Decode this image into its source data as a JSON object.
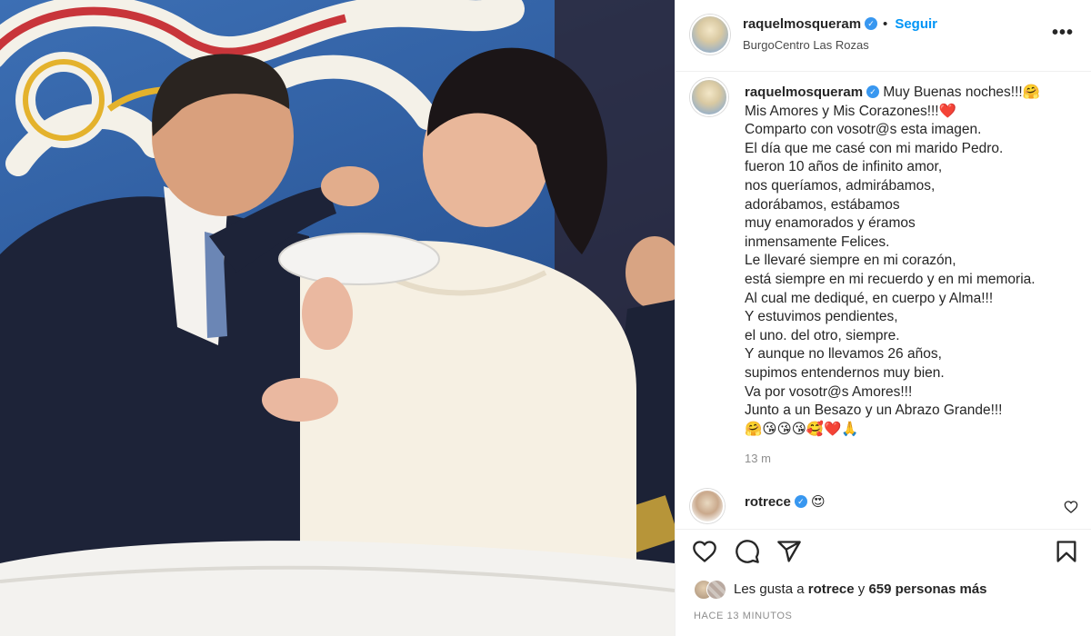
{
  "post": {
    "username": "raquelmosqueram",
    "follow_label": "Seguir",
    "location": "BurgoCentro Las Rozas",
    "more_label": "•••",
    "caption_lines": [
      "Muy Buenas noches!!!🤗",
      "Mis Amores y Mis Corazones!!!❤️",
      "Comparto con vosotr@s esta imagen.",
      "El día que me casé con mi marido Pedro.",
      "fueron 10 años de infinito amor,",
      "nos queríamos, admirábamos,",
      "adorábamos, estábamos",
      "muy enamorados y éramos",
      "inmensamente Felices.",
      "Le llevaré siempre en mi corazón,",
      "está siempre en mi recuerdo y en mi memoria.",
      "Al cual me dediqué, en cuerpo y Alma!!!",
      "Y estuvimos pendientes,",
      "el uno. del otro, siempre.",
      "Y aunque no llevamos 26 años,",
      "supimos entendernos muy bien.",
      "Va por vosotr@s Amores!!!",
      "Junto a un Besazo y un Abrazo Grande!!!",
      "🤗😘😘😘🥰❤️🙏"
    ],
    "caption_time": "13 m",
    "comment": {
      "username": "rotrece",
      "text": "😍"
    },
    "likes": {
      "prefix": "Les gusta a",
      "user": "rotrece",
      "connector": "y",
      "count": "659 personas más"
    },
    "timestamp": "HACE 13 MINUTOS"
  },
  "colors": {
    "accent": "#0095f6",
    "verified": "#3897f0",
    "text": "#262626",
    "muted": "#8e8e8e"
  },
  "icons": [
    "verified-badge-icon",
    "more-options-icon",
    "heart-icon",
    "comment-icon",
    "share-icon",
    "save-icon"
  ]
}
